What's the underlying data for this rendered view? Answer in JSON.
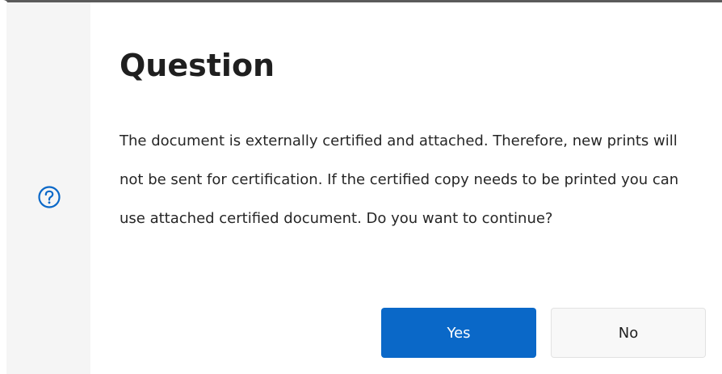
{
  "dialog": {
    "title": "Question",
    "icon": "question-circle-icon",
    "message": "The document is externally certified and attached. Therefore, new prints will not be sent for certification. If the certified copy needs to be printed you can use attached certified document. Do you want to continue?",
    "buttons": {
      "yes_label": "Yes",
      "no_label": "No"
    }
  },
  "colors": {
    "primary": "#0a68c8",
    "icon": "#0a68c8",
    "side_strip": "#f5f5f5"
  }
}
